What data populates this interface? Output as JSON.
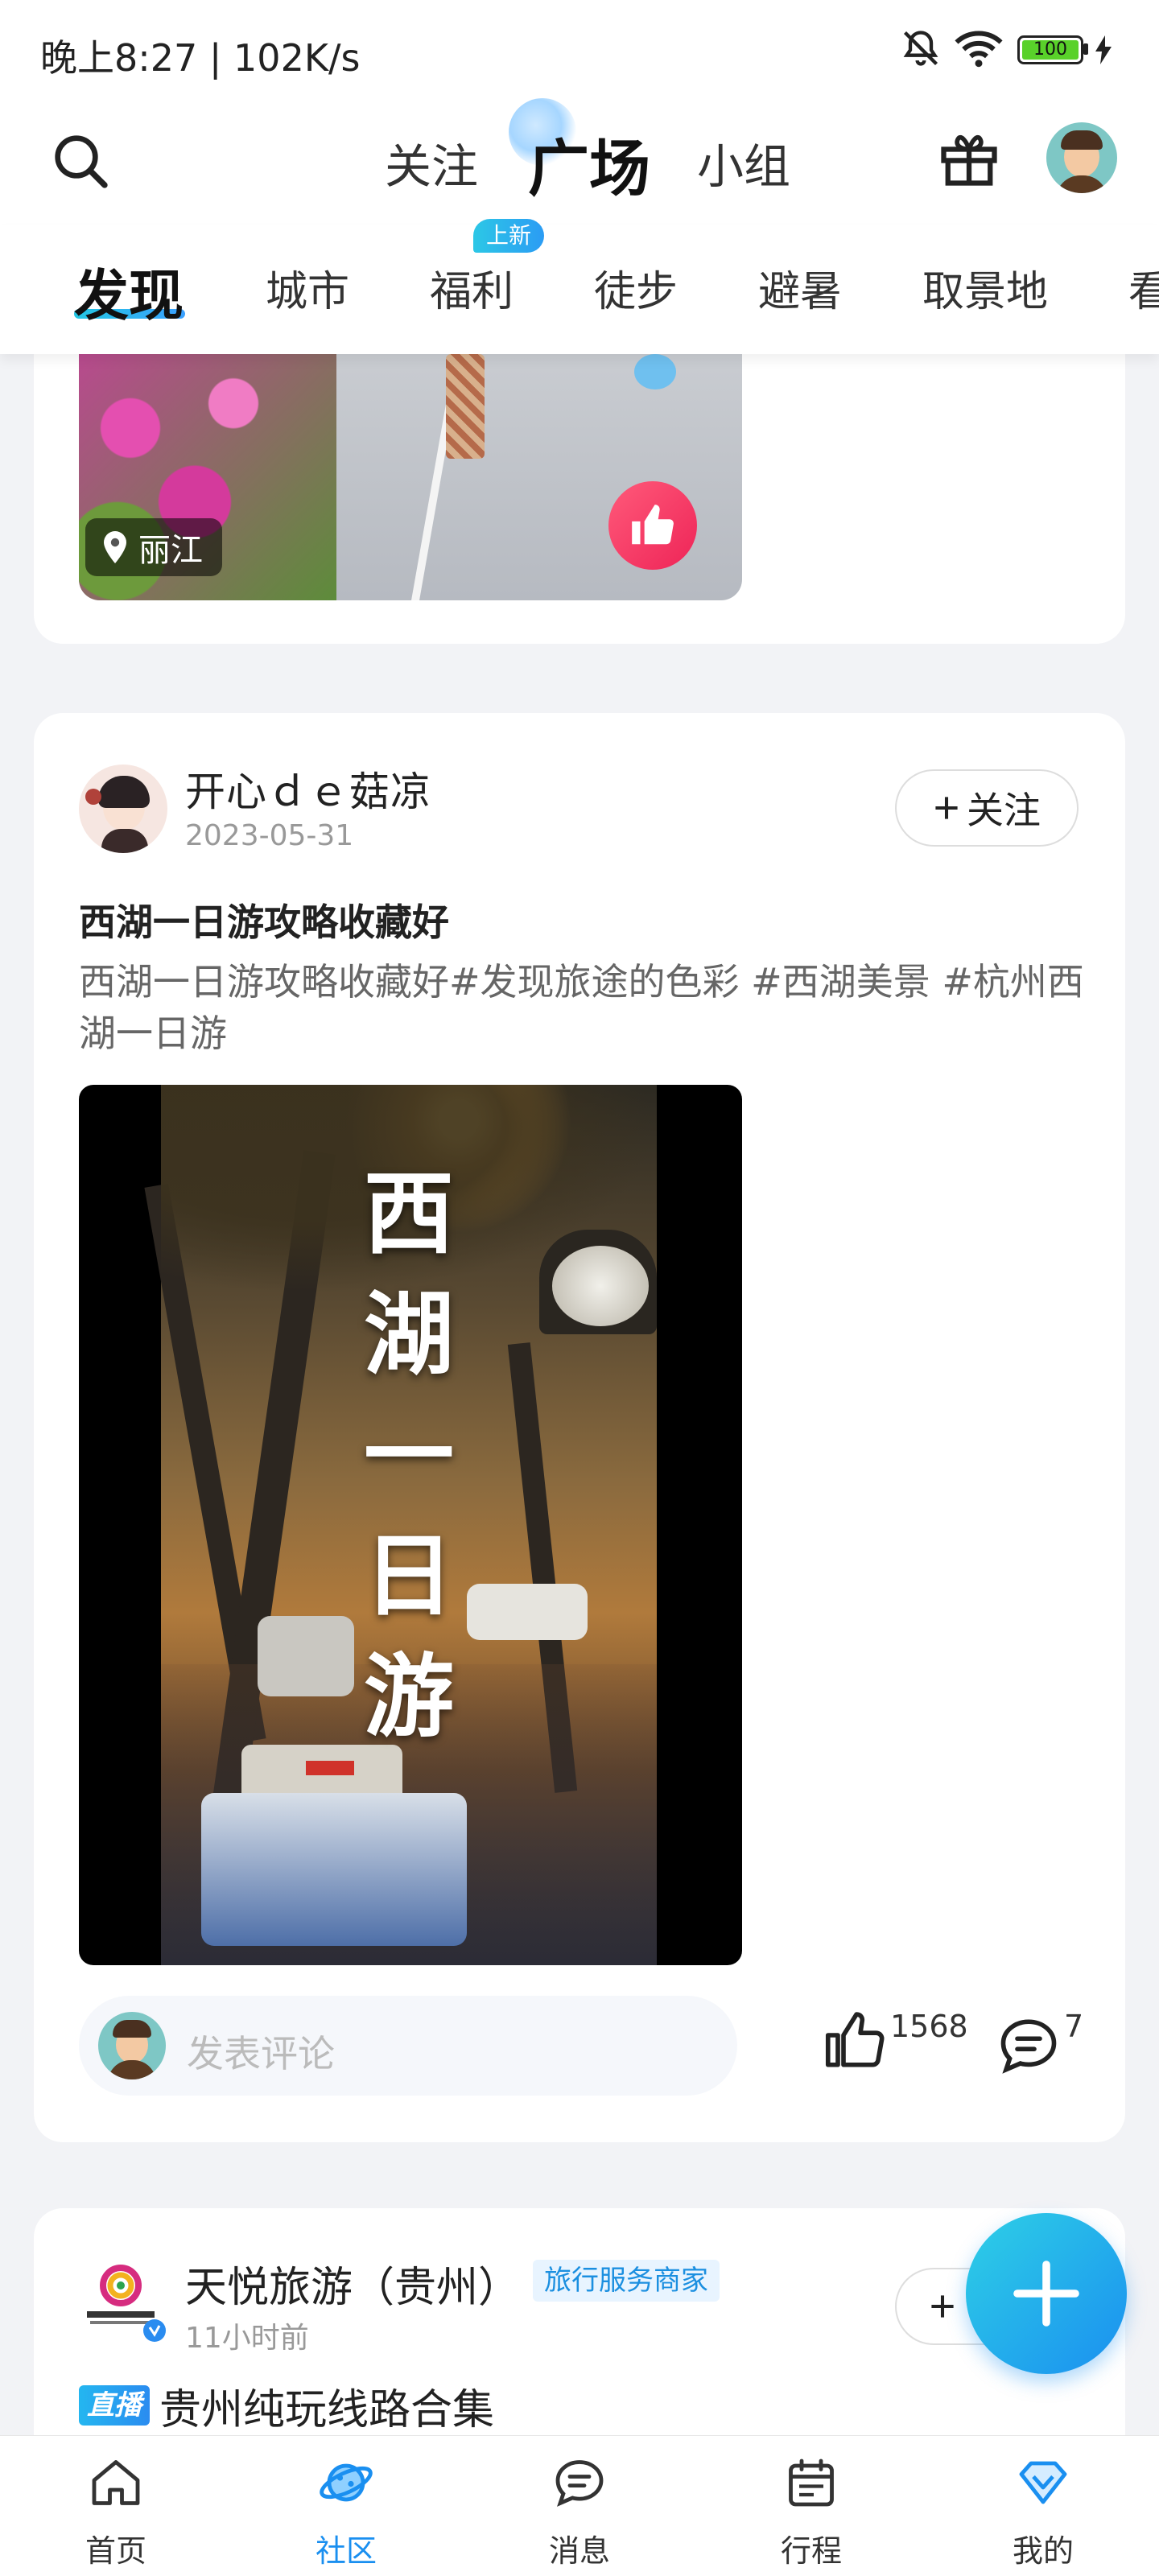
{
  "status_bar": {
    "time": "晚上8:27 | 102K/s",
    "battery": "100"
  },
  "top_nav": {
    "follow": "关注",
    "plaza": "广场",
    "group": "小组"
  },
  "channels": {
    "items": [
      "发现",
      "城市",
      "福利",
      "徒步",
      "避暑",
      "取景地",
      "看"
    ],
    "new_badge": "上新"
  },
  "card1": {
    "location": "丽江"
  },
  "card2": {
    "username": "开心ｄｅ菇凉",
    "date": "2023-05-31",
    "follow_label": "关注",
    "title": "西湖一日游攻略收藏好",
    "body": "西湖一日游攻略收藏好#发现旅途的色彩 #西湖美景 #杭州西湖一日游",
    "image_title_chars": [
      "西",
      "湖",
      "一",
      "日",
      "游"
    ],
    "comment_placeholder": "发表评论",
    "likes": "1568",
    "comments": "7"
  },
  "card3": {
    "username": "天悦旅游（贵州）",
    "merchant_badge": "旅行服务商家",
    "time": "11小时前",
    "live_badge": "直播",
    "title": "贵州纯玩线路合集"
  },
  "bottom_nav": {
    "items": [
      {
        "label": "首页",
        "icon": "home-icon",
        "active": false
      },
      {
        "label": "社区",
        "icon": "planet-icon",
        "active": true
      },
      {
        "label": "消息",
        "icon": "message-icon",
        "active": false
      },
      {
        "label": "行程",
        "icon": "calendar-icon",
        "active": false
      },
      {
        "label": "我的",
        "icon": "diamond-icon",
        "active": false
      }
    ]
  },
  "colors": {
    "accent": "#1a8ff0",
    "like_red": "#ee2457",
    "active_tab": "#1a8ff0"
  }
}
